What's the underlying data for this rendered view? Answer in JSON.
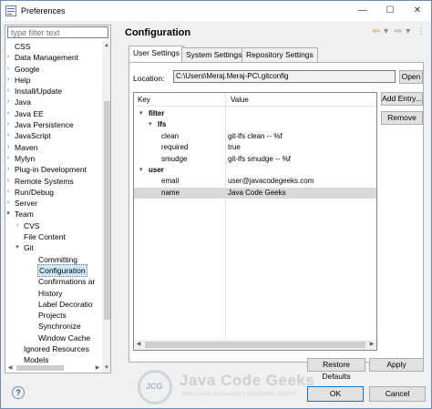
{
  "window": {
    "title": "Preferences",
    "minimize": "—",
    "maximize": "☐",
    "close": "✕"
  },
  "sidebar": {
    "filter_placeholder": "type filter text",
    "items": [
      {
        "label": "CSS",
        "indent": 1,
        "arrow": ""
      },
      {
        "label": "Data Management",
        "indent": 1,
        "arrow": ">"
      },
      {
        "label": "Google",
        "indent": 1,
        "arrow": ">"
      },
      {
        "label": "Help",
        "indent": 1,
        "arrow": ">"
      },
      {
        "label": "Install/Update",
        "indent": 1,
        "arrow": ">"
      },
      {
        "label": "Java",
        "indent": 1,
        "arrow": ">"
      },
      {
        "label": "Java EE",
        "indent": 1,
        "arrow": ">"
      },
      {
        "label": "Java Persistence",
        "indent": 1,
        "arrow": ">"
      },
      {
        "label": "JavaScript",
        "indent": 1,
        "arrow": ">"
      },
      {
        "label": "Maven",
        "indent": 1,
        "arrow": ">"
      },
      {
        "label": "Mylyn",
        "indent": 1,
        "arrow": ">"
      },
      {
        "label": "Plug-in Development",
        "indent": 1,
        "arrow": ">"
      },
      {
        "label": "Remote Systems",
        "indent": 1,
        "arrow": ">"
      },
      {
        "label": "Run/Debug",
        "indent": 1,
        "arrow": ">"
      },
      {
        "label": "Server",
        "indent": 1,
        "arrow": ">"
      },
      {
        "label": "Team",
        "indent": 1,
        "arrow": "v"
      },
      {
        "label": "CVS",
        "indent": 2,
        "arrow": ">"
      },
      {
        "label": "File Content",
        "indent": 2,
        "arrow": ""
      },
      {
        "label": "Git",
        "indent": 2,
        "arrow": "v"
      },
      {
        "label": "Committing",
        "indent": 3,
        "arrow": ""
      },
      {
        "label": "Configuration",
        "indent": 3,
        "arrow": "",
        "selected": true
      },
      {
        "label": "Confirmations ar",
        "indent": 3,
        "arrow": ""
      },
      {
        "label": "History",
        "indent": 3,
        "arrow": ""
      },
      {
        "label": "Label Decoratio",
        "indent": 3,
        "arrow": ""
      },
      {
        "label": "Projects",
        "indent": 3,
        "arrow": ""
      },
      {
        "label": "Synchronize",
        "indent": 3,
        "arrow": ""
      },
      {
        "label": "Window Cache",
        "indent": 3,
        "arrow": ""
      },
      {
        "label": "Ignored Resources",
        "indent": 2,
        "arrow": ""
      },
      {
        "label": "Models",
        "indent": 2,
        "arrow": ""
      }
    ]
  },
  "main": {
    "title": "Configuration",
    "tabs": [
      {
        "label": "User Settings",
        "active": true
      },
      {
        "label": "System Settings",
        "active": false
      },
      {
        "label": "Repository Settings",
        "active": false
      }
    ],
    "location_label": "Location:",
    "location_value": "C:\\Users\\Meraj.Meraj-PC\\.gitconfig",
    "open_button": "Open",
    "add_entry_button": "Add Entry...",
    "remove_button": "Remove",
    "grid": {
      "headers": [
        "Key",
        "Value"
      ],
      "rows": [
        {
          "key": "filter",
          "value": "",
          "level": 0,
          "arrow": "v",
          "bold": true
        },
        {
          "key": "lfs",
          "value": "",
          "level": 1,
          "arrow": "v",
          "bold": true
        },
        {
          "key": "clean",
          "value": "git-lfs clean -- %f",
          "level": 2,
          "arrow": ""
        },
        {
          "key": "required",
          "value": "true",
          "level": 2,
          "arrow": ""
        },
        {
          "key": "smudge",
          "value": "git-lfs smudge -- %f",
          "level": 2,
          "arrow": ""
        },
        {
          "key": "user",
          "value": "",
          "level": 0,
          "arrow": "v",
          "bold": true
        },
        {
          "key": "email",
          "value": "user@javacodegeeks.com",
          "level": 2,
          "arrow": ""
        },
        {
          "key": "name",
          "value": "Java Code Geeks",
          "level": 2,
          "arrow": "",
          "selected": true
        }
      ]
    },
    "restore_defaults_button": "Restore Defaults",
    "apply_button": "Apply"
  },
  "footer": {
    "help_icon": "?",
    "ok_button": "OK",
    "cancel_button": "Cancel"
  },
  "watermark": {
    "badge": "JCG",
    "name": "Java Code Geeks",
    "tagline": "JAVA 2 JAVA DEVELOPERS RESOURCE CENTER"
  }
}
